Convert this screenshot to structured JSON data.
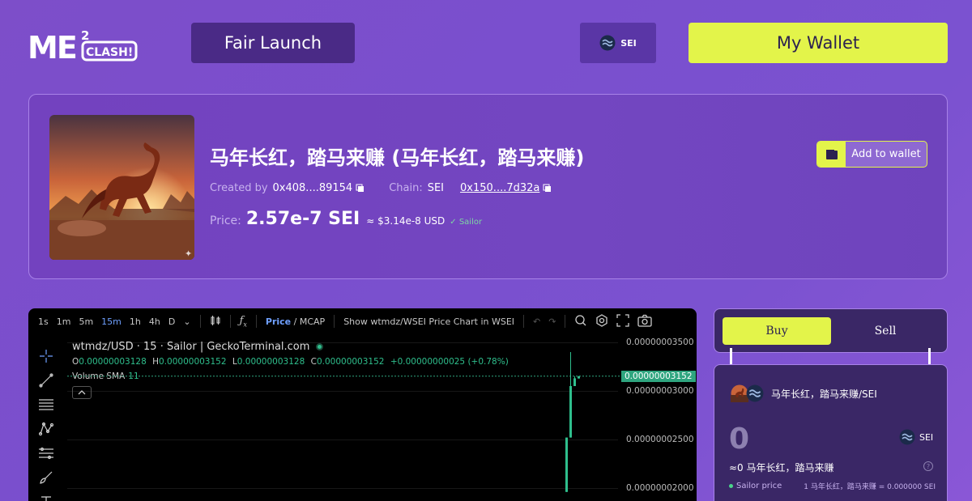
{
  "header": {
    "logo": {
      "main": "ME",
      "sup": "2",
      "badge": "CLASH!"
    },
    "fair_launch_label": "Fair Launch",
    "chain_label": "SEI",
    "wallet_label": "My Wallet"
  },
  "token": {
    "name": "马年长红，踏马来赚 (马年长红，踏马来赚)",
    "created_by_label": "Created by",
    "creator": "0x408....89154",
    "chain_label": "Chain:",
    "chain": "SEI",
    "contract": "0x150....7d32a",
    "price_label": "Price:",
    "price": "2.57e-7 SEI",
    "price_usd": "≈ $3.14e-8 USD",
    "price_source": "✓ Sailor",
    "add_wallet_label": "Add to wallet"
  },
  "chart": {
    "timeframes": [
      "1s",
      "1m",
      "5m",
      "15m",
      "1h",
      "4h",
      "D"
    ],
    "active_timeframe": "15m",
    "price_label": "Price",
    "mcap_label": "/ MCAP",
    "show_label": "Show wtmdz/WSEI Price Chart in WSEI",
    "title": "wtmdz/USD · 15 · Sailor | GeckoTerminal.com",
    "ohlc": {
      "o_key": "O",
      "o": "0.00000003128",
      "h_key": "H",
      "h": "0.00000003152",
      "l_key": "L",
      "l": "0.00000003128",
      "c_key": "C",
      "c": "0.00000003152",
      "change": "+0.00000000025 (+0.78%)"
    },
    "volume_label": "Volume SMA",
    "volume_value": "11",
    "current_price": "0.00000003152",
    "y_ticks": [
      "0.00000003500",
      "0.00000003000",
      "0.00000002500",
      "0.00000002000"
    ]
  },
  "chart_data": {
    "type": "line",
    "title": "wtmdz/USD · 15 · Sailor | GeckoTerminal.com",
    "xlabel": "",
    "ylabel": "",
    "ylim": [
      1.9e-08,
      3.6e-08
    ],
    "y_ticks": [
      3.5e-08,
      3e-08,
      2.5e-08,
      2e-08
    ],
    "candles": [
      {
        "o": 1.96e-08,
        "h": 2.52e-08,
        "l": 1.96e-08,
        "c": 2.52e-08
      },
      {
        "o": 2.52e-08,
        "h": 3.4e-08,
        "l": 2.52e-08,
        "c": 3.05e-08
      },
      {
        "o": 3.05e-08,
        "h": 3.15e-08,
        "l": 3.05e-08,
        "c": 3.13e-08
      },
      {
        "o": 3.128e-08,
        "h": 3.152e-08,
        "l": 3.128e-08,
        "c": 3.152e-08
      }
    ],
    "grid": true
  },
  "trade": {
    "buy_label": "Buy",
    "sell_label": "Sell",
    "pair_label": "马年长红，踏马来赚/SEI",
    "amount_placeholder": "0",
    "currency": "SEI",
    "approx": "≈0 马年长红，踏马来赚",
    "help": "?",
    "rate_label": "Sailor price",
    "rate_value": "1 马年长红，踏马来赚 = 0.000000 SEI"
  },
  "colors": {
    "accent": "#e3f44a",
    "panel": "#3a2766",
    "up": "#2fbf8d"
  }
}
